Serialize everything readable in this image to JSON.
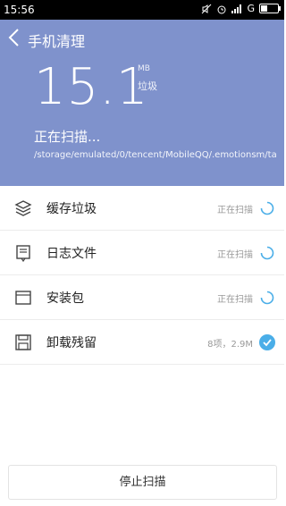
{
  "status_bar": {
    "time": "15:56",
    "network": "G"
  },
  "header": {
    "title": "手机清理",
    "size_value": "15.1",
    "size_unit": "MB",
    "size_unit_label": "垃圾",
    "scanning_label": "正在扫描...",
    "scan_path": "/storage/emulated/0/tencent/MobileQQ/.emotionsm/ta."
  },
  "items": [
    {
      "label": "缓存垃圾",
      "status": "正在扫描",
      "icon": "layers-icon",
      "state": "scanning"
    },
    {
      "label": "日志文件",
      "status": "正在扫描",
      "icon": "log-book-icon",
      "state": "scanning"
    },
    {
      "label": "安装包",
      "status": "正在扫描",
      "icon": "package-icon",
      "state": "scanning"
    },
    {
      "label": "卸载残留",
      "status": "8项，2.9M",
      "icon": "floppy-icon",
      "state": "done"
    }
  ],
  "stop_button": "停止扫描",
  "colors": {
    "header_bg": "#7f92cc",
    "accent": "#4aaee8"
  }
}
